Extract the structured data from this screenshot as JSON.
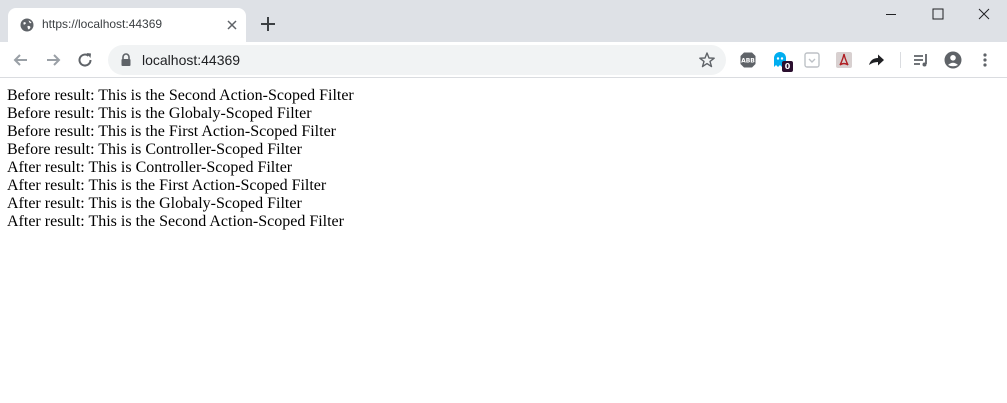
{
  "tab": {
    "title": "https://localhost:44369"
  },
  "address_bar": {
    "url": "localhost:44369"
  },
  "extensions": {
    "ghost_badge": "0"
  },
  "page": {
    "lines": [
      "Before result: This is the Second Action-Scoped Filter",
      "Before result: This is the Globaly-Scoped Filter",
      "Before result: This is the First Action-Scoped Filter",
      "Before result: This is Controller-Scoped Filter",
      "After result: This is Controller-Scoped Filter",
      "After result: This is the First Action-Scoped Filter",
      "After result: This is the Globaly-Scoped Filter",
      "After result: This is the Second Action-Scoped Filter"
    ]
  }
}
